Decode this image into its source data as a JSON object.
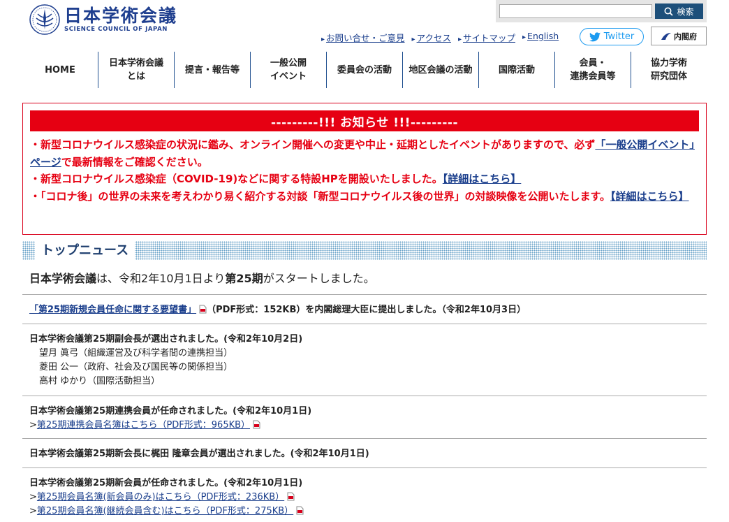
{
  "header": {
    "logo_jp": "日本学術会議",
    "logo_en": "SCIENCE COUNCIL OF JAPAN"
  },
  "search": {
    "placeholder": "",
    "button_label": "検索"
  },
  "utility_nav": [
    "お問い合せ・ご意見",
    "アクセス",
    "サイトマップ",
    "English"
  ],
  "twitter_label": "Twitter",
  "cabinet_label": "内閣府",
  "main_nav": [
    "HOME",
    "日本学術会議\nとは",
    "提言・報告等",
    "一般公開\nイベント",
    "委員会の活動",
    "地区会議の活動",
    "国際活動",
    "会員・\n連携会員等",
    "協力学術\n研究団体"
  ],
  "notice": {
    "title": "---------!!! お知らせ !!!---------",
    "line1_text": "・新型コロナウイルス感染症の状況に鑑み、オンライン開催への変更や中止・延期としたイベントがありますので、必ず",
    "line1_link": "「一般公開イベント」ページ",
    "line1_tail": "で最新情報をご確認ください。",
    "line2_text": "・新型コロナウイルス感染症（COVID-19)などに関する特設HPを開設いたしました。",
    "line2_link": "【詳細はこちら】",
    "line3_text": "・「コロナ後」の世界の未来を考えわかり易く紹介する対談「新型コロナウイルス後の世界」の対談映像を公開いたします。",
    "line3_link": "【詳細はこちら】"
  },
  "top_news": {
    "header": "トップニュース",
    "lead_part1": "日本学術会議",
    "lead_part2": "は、令和2年10月1日より",
    "lead_part3": "第25期",
    "lead_part4": "がスタートしました。",
    "item1": {
      "link": "「第25期新規会員任命に関する要望書」",
      "tail": "（PDF形式：152KB）を内閣総理大臣に提出しました。（令和2年10月3日）"
    },
    "item2": {
      "title": "日本学術会議第25期副会長が選出されました。(令和2年10月2日)",
      "lines": [
        "望月 眞弓（組織運営及び科学者間の連携担当）",
        "菱田 公一（政府、社会及び国民等の関係担当）",
        "高村 ゆかり（国際活動担当）"
      ]
    },
    "item3": {
      "title": "日本学術会議第25期連携会員が任命されました。(令和2年10月1日)",
      "link": "第25期連携会員名簿はこちら（PDF形式：965KB）"
    },
    "item4": {
      "title": "日本学術会議第25期新会長に梶田 隆章会員が選出されました。(令和2年10月1日)"
    },
    "item5": {
      "title": "日本学術会議第25期新会員が任命されました。(令和2年10月1日)",
      "link1": "第25期会員名簿(新会員のみ)はこちら（PDF形式：236KB）",
      "link2": "第25期会員名簿(継続会員含む)はこちら（PDF形式：275KB）"
    }
  }
}
